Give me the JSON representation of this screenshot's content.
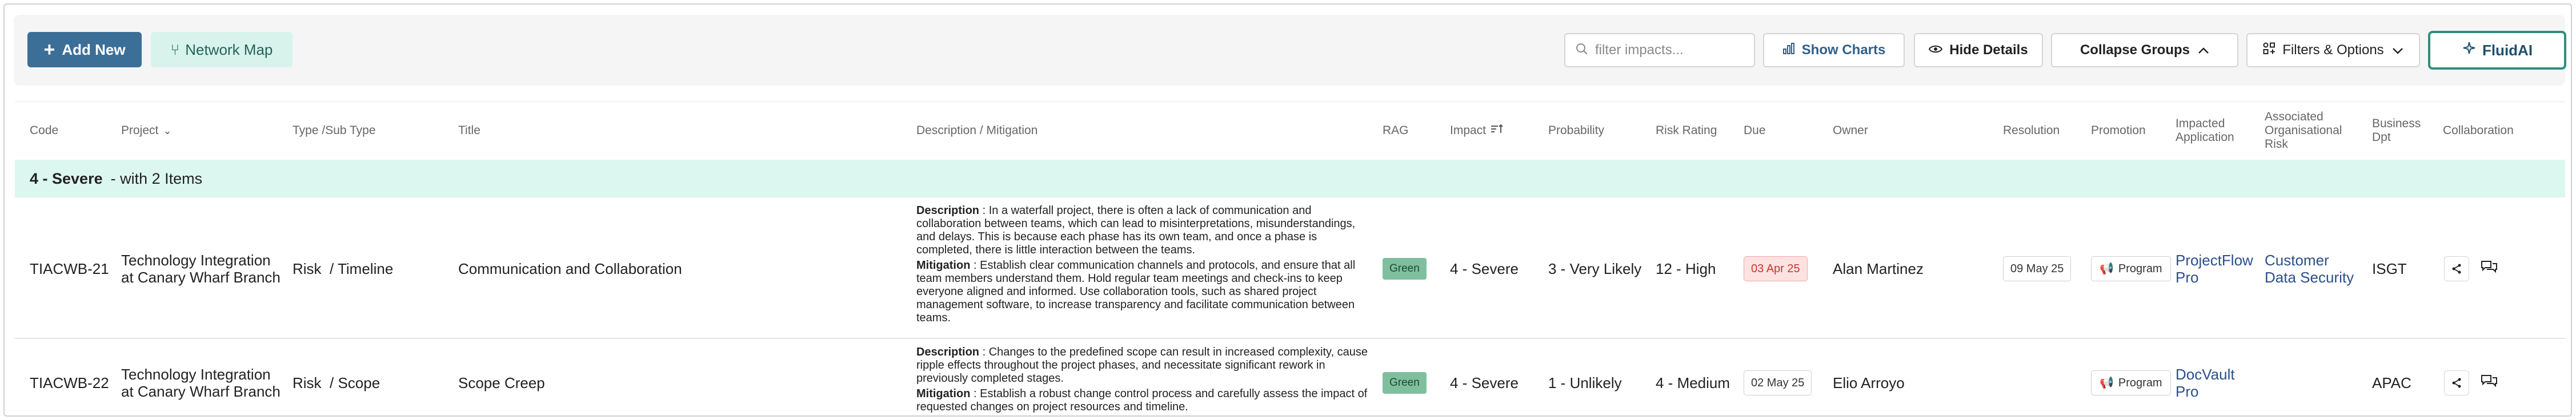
{
  "toolbar": {
    "add_new_label": "Add New",
    "network_map_label": "Network Map",
    "search_placeholder": "filter impacts...",
    "show_charts_label": "Show Charts",
    "hide_details_label": "Hide Details",
    "collapse_groups_label": "Collapse Groups",
    "filters_label": "Filters & Options",
    "fluidai_label": "FluidAI"
  },
  "columns": {
    "code": "Code",
    "project": "Project",
    "type": "Type /Sub Type",
    "title": "Title",
    "description": "Description / Mitigation",
    "rag": "RAG",
    "impact": "Impact",
    "probability": "Probability",
    "risk_rating": "Risk Rating",
    "due": "Due",
    "owner": "Owner",
    "resolution": "Resolution",
    "promotion": "Promotion",
    "impacted_application": "Impacted Application",
    "associated_risk": "Associated Organisational Risk",
    "business_dpt": "Business Dpt",
    "collaboration": "Collaboration"
  },
  "group": {
    "title": "4 - Severe",
    "subtitle": "- with 2 Items"
  },
  "rows": [
    {
      "code": "TIACWB-21",
      "project": "Technology Integration at Canary Wharf Branch",
      "type": "Risk",
      "subtype": "/ Timeline",
      "title": "Communication and Collaboration",
      "description_label": "Description",
      "description": " : In a waterfall project, there is often a lack of communication and collaboration between teams, which can lead to misinterpretations, misunderstandings, and delays. This is because each phase has its own team, and once a phase is completed, there is little interaction between the teams.",
      "mitigation_label": "Mitigation",
      "mitigation": " : Establish clear communication channels and protocols, and ensure that all team members understand them. Hold regular team meetings and check-ins to keep everyone aligned and informed. Use collaboration tools, such as shared project management software, to increase transparency and facilitate communication between teams.",
      "rag": "Green",
      "impact": "4 - Severe",
      "probability": "3 - Very Likely",
      "risk_rating": "12 - High",
      "due": "03 Apr 25",
      "owner": "Alan Martinez",
      "resolution": "09 May 25",
      "promotion": "Program",
      "impacted_application": "ProjectFlow Pro",
      "associated_risk": "Customer Data Security",
      "business_dpt": "ISGT"
    },
    {
      "code": "TIACWB-22",
      "project": "Technology Integration at Canary Wharf Branch",
      "type": "Risk",
      "subtype": "/ Scope",
      "title": "Scope Creep",
      "description_label": "Description",
      "description": " : Changes to the predefined scope can result in increased complexity, cause ripple effects throughout the project phases, and necessitate significant rework in previously completed stages.",
      "mitigation_label": "Mitigation",
      "mitigation": " : Establish a robust change control process and carefully assess the impact of requested changes on project resources and timeline.",
      "rag": "Green",
      "impact": "4 - Severe",
      "probability": "1 - Unlikely",
      "risk_rating": "4 - Medium",
      "due": "02 May 25",
      "owner": "Elio Arroyo",
      "resolution": "",
      "promotion": "Program",
      "impacted_application": "DocVault Pro",
      "associated_risk": "",
      "business_dpt": "APAC"
    }
  ],
  "colors": {
    "primary": "#3b6f98",
    "accent_teal": "#2e8f7b",
    "group_bg": "#dcf7f0",
    "rag_green": "#7fbf9e",
    "overdue_red": "#c0392b"
  }
}
